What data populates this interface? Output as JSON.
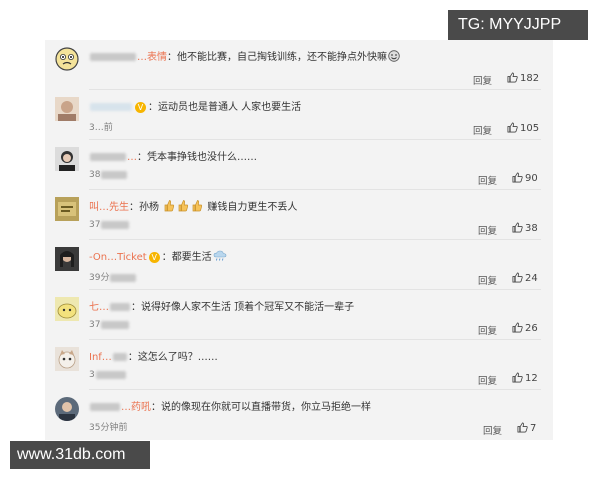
{
  "watermark_top": "TG: MYYJJPP",
  "watermark_bottom": "www.31db.com",
  "comments": [
    {
      "user": "…表情",
      "text": "他不能比赛，自己掏钱训练，还不能挣点外快嘛",
      "time": "",
      "reply": "回复",
      "likes": "182"
    },
    {
      "user": "",
      "text": "运动员也是普通人 人家也要生活",
      "time": "3…前",
      "reply": "回复",
      "likes": "105"
    },
    {
      "user": "…",
      "text": "凭本事挣钱也没什么……",
      "time": "38",
      "reply": "回复",
      "likes": "90"
    },
    {
      "user": "叫…先生",
      "text": "孙杨",
      "text2": "赚钱自力更生不丢人",
      "time": "37",
      "reply": "回复",
      "likes": "38"
    },
    {
      "user": "-On…Ticket",
      "text": "都要生活",
      "time": "39分",
      "reply": "回复",
      "likes": "24"
    },
    {
      "user": "七…",
      "text": "说得好像人家不生活 顶着个冠军又不能活一辈子",
      "time": "37",
      "reply": "回复",
      "likes": "26"
    },
    {
      "user": "Inf…",
      "text": "这怎么了吗？……",
      "time": "3",
      "reply": "回复",
      "likes": "12"
    },
    {
      "user": "…药吼",
      "text": "说的像现在你就可以直播带货，你立马拒绝一样",
      "time": "35分钟前",
      "reply": "回复",
      "likes": "7"
    }
  ]
}
